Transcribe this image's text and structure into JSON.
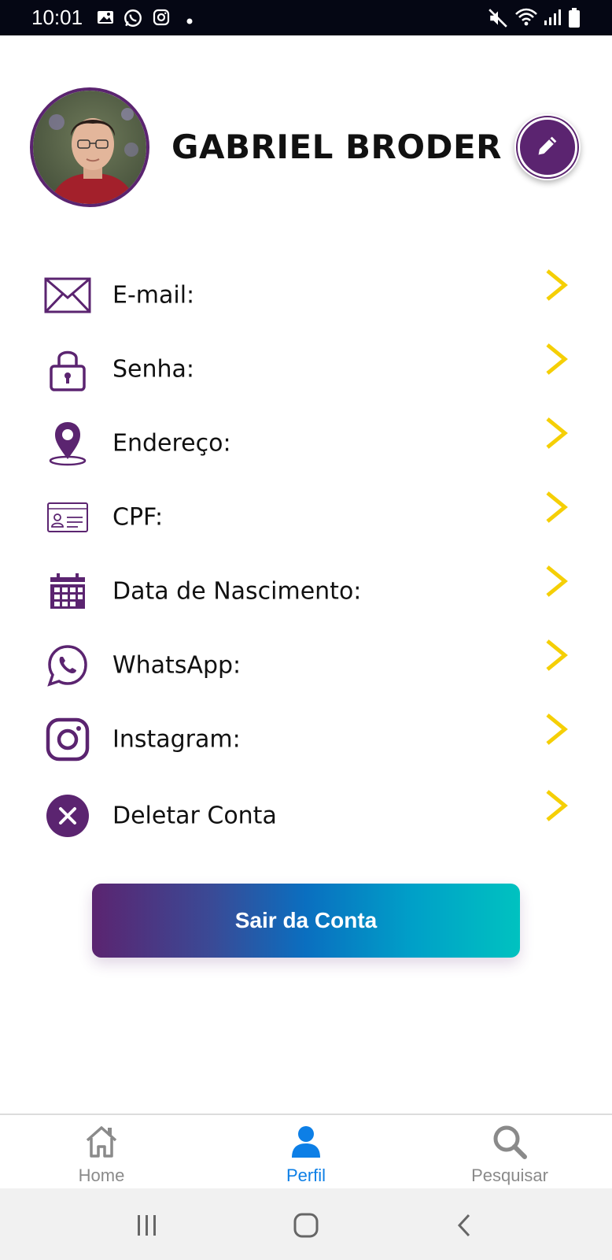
{
  "status_bar": {
    "time": "10:01",
    "left_icons": [
      "image-icon",
      "whatsapp-icon",
      "instagram-icon",
      "dot-icon"
    ],
    "right_icons": [
      "mute-icon",
      "wifi-icon",
      "signal-icon",
      "battery-icon"
    ]
  },
  "profile": {
    "name": "GABRIEL BRODER",
    "avatar_icon": "profile-photo",
    "edit_icon": "pencil-icon"
  },
  "menu": {
    "items": [
      {
        "label": "E-mail:",
        "icon": "envelope-icon"
      },
      {
        "label": "Senha:",
        "icon": "lock-icon"
      },
      {
        "label": "Endereço:",
        "icon": "location-pin-icon"
      },
      {
        "label": "CPF:",
        "icon": "id-card-icon"
      },
      {
        "label": "Data de Nascimento:",
        "icon": "calendar-icon"
      },
      {
        "label": "WhatsApp:",
        "icon": "whatsapp-icon"
      },
      {
        "label": "Instagram:",
        "icon": "instagram-icon"
      },
      {
        "label": "Deletar Conta",
        "icon": "close-circle-icon"
      }
    ],
    "chevron_icon": "chevron-right-icon"
  },
  "logout": {
    "label": "Sair da Conta"
  },
  "bottom_nav": {
    "items": [
      {
        "label": "Home",
        "icon": "home-icon",
        "active": false
      },
      {
        "label": "Perfil",
        "icon": "user-icon",
        "active": true
      },
      {
        "label": "Pesquisar",
        "icon": "search-icon",
        "active": false
      }
    ]
  },
  "system_nav": {
    "icons": [
      "recents-icon",
      "home-circle-icon",
      "back-icon"
    ]
  },
  "colors": {
    "brand_purple": "#5b2470",
    "chevron_yellow": "#f5cf06",
    "active_blue": "#0d7fe6",
    "inactive_gray": "#8a8a8a",
    "gradient_start": "#5b2470",
    "gradient_end": "#00c2c0"
  }
}
